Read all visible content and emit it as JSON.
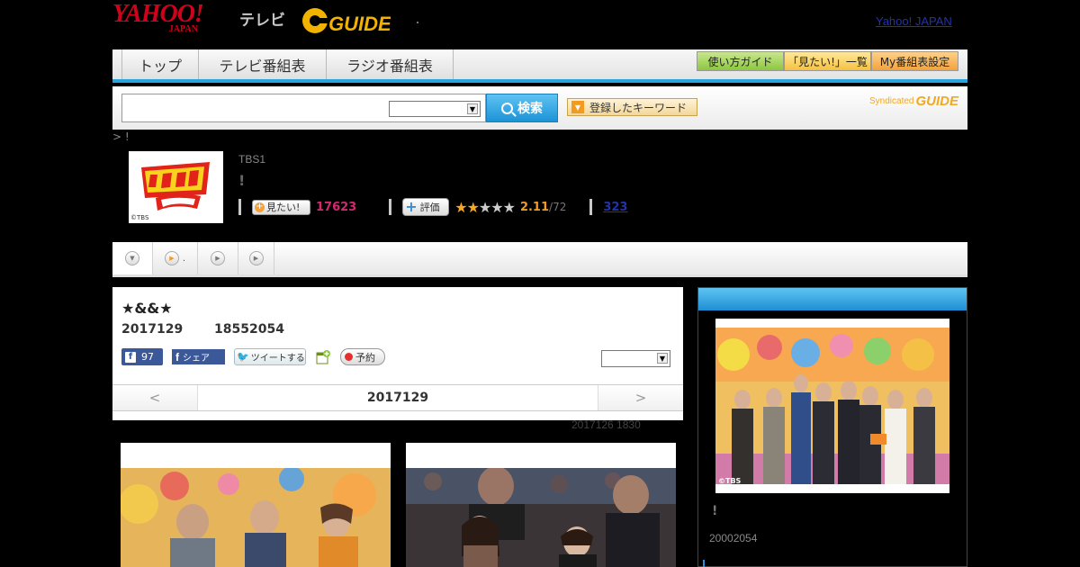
{
  "header": {
    "logo_main": "YAHOO!",
    "logo_sub": "JAPAN",
    "tv_label": "テレビ",
    "gguide_label": "GUIDE",
    "yahoo_japan_link": "Yahoo! JAPAN"
  },
  "nav": {
    "tabs": [
      {
        "label": "トップ"
      },
      {
        "label": "テレビ番組表"
      },
      {
        "label": "ラジオ番組表"
      }
    ],
    "guide_button": "使い方ガイド",
    "mitai_list_button": "「見たい!」一覧",
    "my_settings_button": "My番組表設定"
  },
  "search": {
    "input_value": "",
    "select_value": "",
    "button_label": "検索",
    "keyword_button": "登録したキーワード",
    "syndicated_label": "Syndicated",
    "syndicated_logo": "GUIDE"
  },
  "breadcrumb": "> !",
  "program": {
    "channel": "TBS1",
    "title": "!",
    "thumb_credit": "©TBS",
    "mitai_label": "見たい!",
    "mitai_count": "17623",
    "hyouka_label": "評価",
    "rating_fraction": 0.422,
    "score": "2.11",
    "score_total": "/72",
    "review_count": "323"
  },
  "episode": {
    "title": "★&&★",
    "date": "2017129",
    "time": "18552054",
    "fb_count": "97",
    "fb_share_label": "シェア",
    "tweet_label": "ツイートする",
    "reserve_label": "予約",
    "select_value": "",
    "nav_prev": "<",
    "nav_date": "2017129",
    "nav_next": ">",
    "updated": "2017126  1830"
  },
  "sidebar": {
    "photo_credit": "©TBS",
    "title": "!",
    "time": "20002054"
  },
  "colors": {
    "accent_blue": "#27a4e0",
    "mitai_pink": "#d22970",
    "star_orange": "#f5a623",
    "link_blue": "#2233aa"
  }
}
